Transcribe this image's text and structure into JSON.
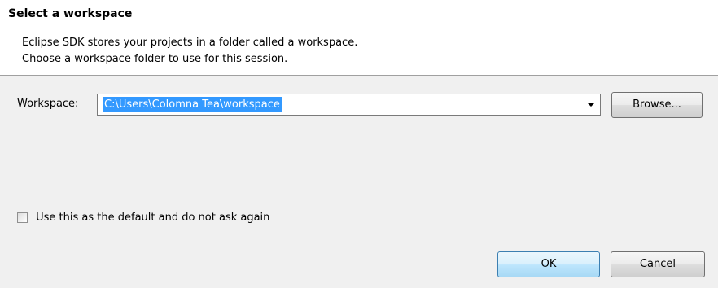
{
  "header": {
    "title": "Select a workspace",
    "description_line1": "Eclipse SDK stores your projects in a folder called a workspace.",
    "description_line2": "Choose a workspace folder to use for this session."
  },
  "workspace": {
    "label": "Workspace:",
    "value": "C:\\Users\\Colomna Tea\\workspace",
    "browse_label": "Browse..."
  },
  "default_option": {
    "label": "Use this as the default and do not ask again",
    "checked": false
  },
  "buttons": {
    "ok_label": "OK",
    "cancel_label": "Cancel"
  },
  "icons": {
    "combo_arrow": "chevron-down-icon"
  },
  "colors": {
    "selection": "#3399ff",
    "header_bg": "#ffffff",
    "dialog_bg": "#f0f0f0"
  }
}
